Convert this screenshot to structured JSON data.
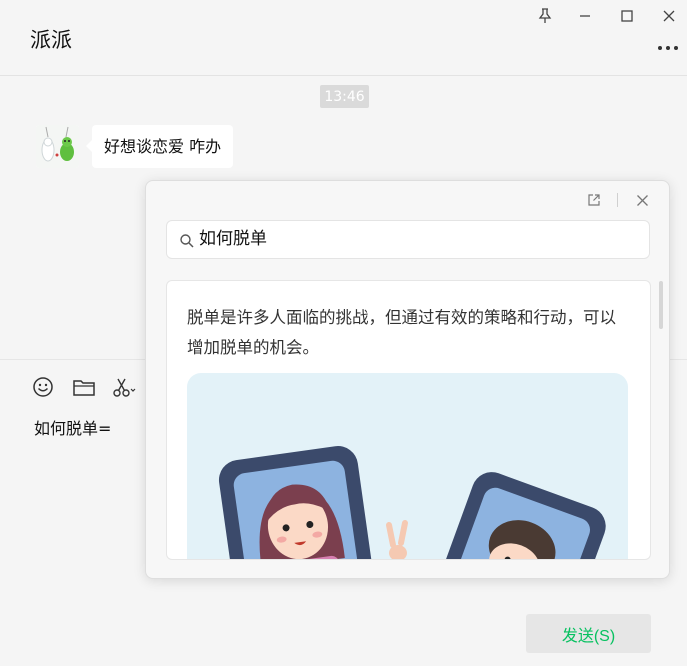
{
  "window": {
    "title": "派派",
    "icons": [
      "pin-icon",
      "minimize-icon",
      "maximize-icon",
      "close-icon",
      "more-icon"
    ]
  },
  "messages": {
    "time": "13:46",
    "items": [
      {
        "sender": "avatar",
        "text": "好想谈恋爱 咋办"
      }
    ]
  },
  "input": {
    "toolbar_icons": [
      "emoji-icon",
      "folder-icon",
      "scissors-icon"
    ],
    "text": "如何脱单=",
    "send_label": "发送(S)"
  },
  "popup": {
    "icons": [
      "open-external-icon",
      "close-icon"
    ],
    "search": {
      "query": "如何脱单"
    },
    "answer": {
      "text": "脱单是许多人面临的挑战，但通过有效的策略和行动，可以增加脱单的机会。"
    }
  },
  "colors": {
    "accent": "#07c160",
    "background": "#f5f5f5",
    "illustration_bg": "#e3f2f8"
  }
}
